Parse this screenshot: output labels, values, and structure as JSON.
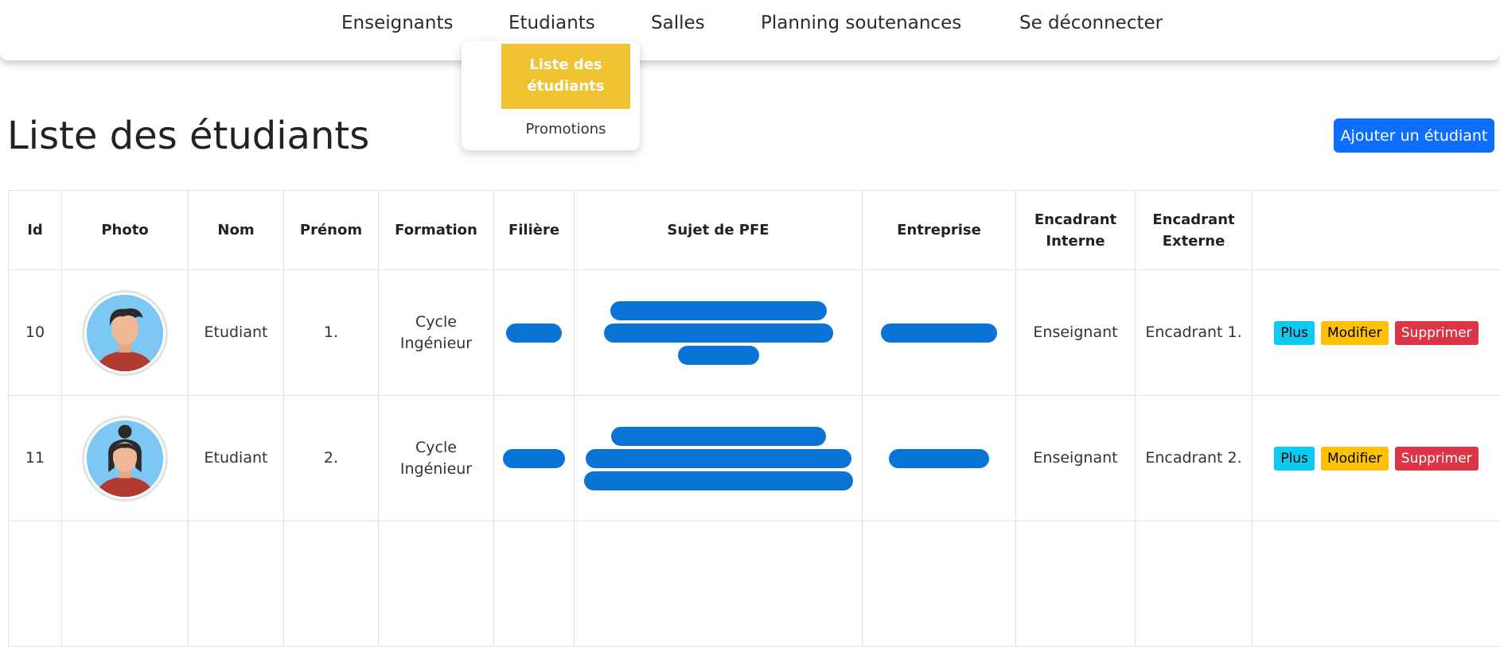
{
  "nav": {
    "items": [
      "Enseignants",
      "Etudiants",
      "Salles",
      "Planning soutenances",
      "Se déconnecter"
    ]
  },
  "dropdown": {
    "active_label": "Liste des étudiants",
    "items": [
      "Promotions"
    ]
  },
  "page": {
    "title": "Liste des étudiants",
    "add_button": "Ajouter un étudiant"
  },
  "table": {
    "headers": [
      "Id",
      "Photo",
      "Nom",
      "Prénom",
      "Formation",
      "Filière",
      "Sujet de PFE",
      "Entreprise",
      "Encadrant Interne",
      "Encadrant Externe",
      ""
    ],
    "rows": [
      {
        "id": "10",
        "nom": "Etudiant",
        "prenom": "1.",
        "formation": "Cycle Ingénieur",
        "encadrant_interne": "Enseignant",
        "encadrant_externe": "Encadrant 1.",
        "avatar": "male"
      },
      {
        "id": "11",
        "nom": "Etudiant",
        "prenom": "2.",
        "formation": "Cycle Ingénieur",
        "encadrant_interne": "Enseignant",
        "encadrant_externe": "Encadrant 2.",
        "avatar": "female"
      }
    ],
    "actions": {
      "plus": "Plus",
      "modifier": "Modifier",
      "supprimer": "Supprimer"
    }
  },
  "colors": {
    "accent_yellow": "#efc332",
    "primary": "#0d6efd",
    "redaction": "#0a74d6"
  }
}
